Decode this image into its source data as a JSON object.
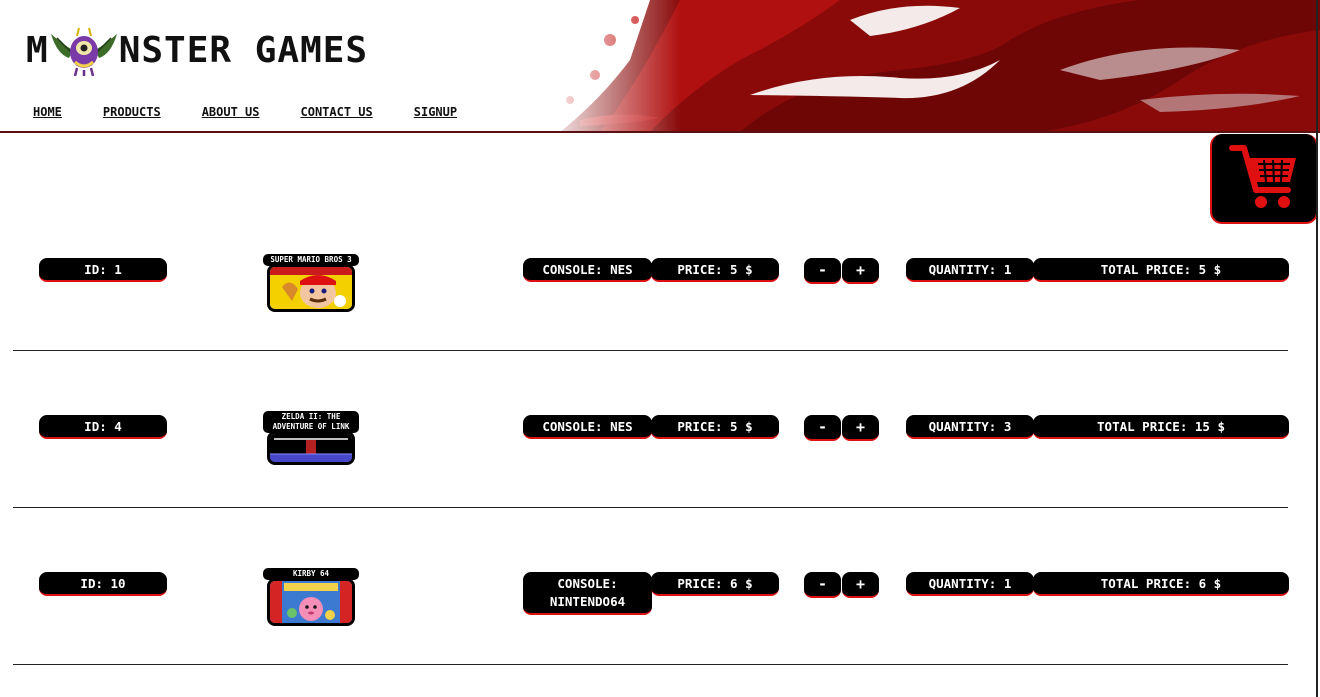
{
  "brand": {
    "logo_m": "M",
    "logo_rest": "NSTER GAMES"
  },
  "nav": {
    "items": [
      {
        "label": "HOME"
      },
      {
        "label": "PRODUCTS"
      },
      {
        "label": "ABOUT US"
      },
      {
        "label": "CONTACT US"
      },
      {
        "label": "SIGNUP"
      }
    ]
  },
  "cart_icon": "shopping-cart-icon",
  "colors": {
    "accent": "#dd1111",
    "pill_bg": "#000000",
    "text_on_dark": "#ffffff"
  },
  "cart": {
    "items": [
      {
        "id_label": "ID: 1",
        "game_title": "SUPER MARIO BROS 3",
        "console_label": "CONSOLE: NES",
        "console_line2": "",
        "price_label": "PRICE: 5 $",
        "minus_label": "-",
        "plus_label": "+",
        "quantity_label": "QUANTITY: 1",
        "total_label": "TOTAL PRICE: 5 $"
      },
      {
        "id_label": "ID: 4",
        "game_title": "ZELDA II: THE ADVENTURE OF LINK",
        "console_label": "CONSOLE: NES",
        "console_line2": "",
        "price_label": "PRICE: 5 $",
        "minus_label": "-",
        "plus_label": "+",
        "quantity_label": "QUANTITY: 3",
        "total_label": "TOTAL PRICE: 15 $"
      },
      {
        "id_label": "ID: 10",
        "game_title": "KIRBY 64",
        "console_label": "CONSOLE:",
        "console_line2": "NINTENDO64",
        "price_label": "PRICE: 6 $",
        "minus_label": "-",
        "plus_label": "+",
        "quantity_label": "QUANTITY: 1",
        "total_label": "TOTAL PRICE: 6 $"
      }
    ]
  }
}
